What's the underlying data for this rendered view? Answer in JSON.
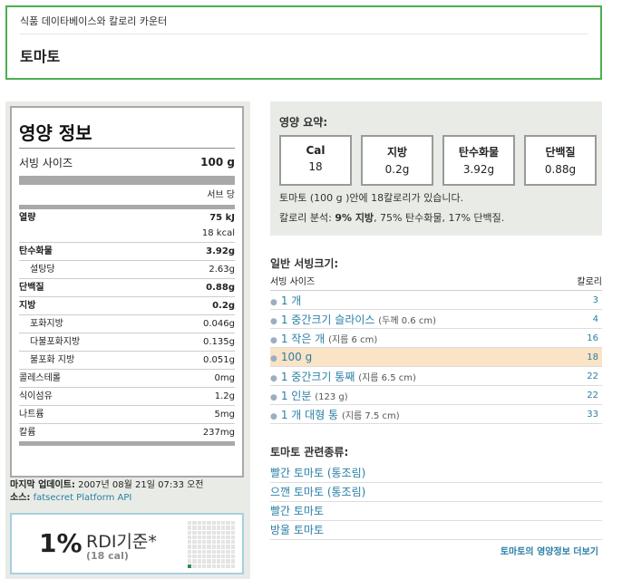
{
  "header": {
    "breadcrumb": "식품 데이타베이스와 칼로리 카운터",
    "title": "토마토"
  },
  "facts": {
    "title": "영양 정보",
    "serving_label": "서빙 사이즈",
    "serving_value": "100 g",
    "per_serving": "서브 당",
    "rows": [
      {
        "k": "열량",
        "v": "75 kJ"
      },
      {
        "k": "",
        "v": "18 kcal"
      },
      {
        "k": "탄수화물",
        "v": "3.92g"
      },
      {
        "k": "설탕당",
        "v": "2.63g"
      },
      {
        "k": "단백질",
        "v": "0.88g"
      },
      {
        "k": "지방",
        "v": "0.2g"
      },
      {
        "k": "포화지방",
        "v": "0.046g"
      },
      {
        "k": "다불포화지방",
        "v": "0.135g"
      },
      {
        "k": "불포화 지방",
        "v": "0.051g"
      },
      {
        "k": "콜레스테롤",
        "v": "0mg"
      },
      {
        "k": "식이섬유",
        "v": "1.2g"
      },
      {
        "k": "나트륨",
        "v": "5mg"
      },
      {
        "k": "칼륨",
        "v": "237mg"
      }
    ]
  },
  "meta": {
    "updated_label": "마지막 업데이트:",
    "updated_value": "2007년 08월 21일 07:33 오전",
    "source_label": "소스:",
    "source_link": "fatsecret Platform API"
  },
  "rdi": {
    "percent": "1%",
    "label": "RDI기준*",
    "cal": "(18 cal)",
    "fraction": 0.01
  },
  "summary": {
    "heading": "영양 요약:",
    "macros": [
      {
        "k": "Cal",
        "v": "18"
      },
      {
        "k": "지방",
        "v": "0.2g"
      },
      {
        "k": "탄수화물",
        "v": "3.92g"
      },
      {
        "k": "단백질",
        "v": "0.88g"
      }
    ],
    "line1": "토마토 (100 g )안에 18칼로리가 있습니다.",
    "line2_prefix": "칼로리 분석: ",
    "line2_bold": "9% 지방",
    "line2_rest": ", 75% 탄수화물, 17% 단백질."
  },
  "servings": {
    "heading": "일반 서빙크기:",
    "col_size": "서빙 사이즈",
    "col_cal": "칼로리",
    "rows": [
      {
        "label": "1 개",
        "sub": "",
        "cal": "3"
      },
      {
        "label": "1 중간크기 슬라이스",
        "sub": "(두께 0.6 cm)",
        "cal": "4"
      },
      {
        "label": "1 작은 개",
        "sub": "(지름 6 cm)",
        "cal": "16"
      },
      {
        "label": "100 g",
        "sub": "",
        "cal": "18"
      },
      {
        "label": "1 중간크기 통째",
        "sub": "(지름 6.5 cm)",
        "cal": "22"
      },
      {
        "label": "1 인분",
        "sub": "(123 g)",
        "cal": "22"
      },
      {
        "label": "1 개 대형 통",
        "sub": "(지름 7.5 cm)",
        "cal": "33"
      }
    ]
  },
  "related": {
    "heading": "토마토 관련종류:",
    "items": [
      "빨간 토마토 (통조림)",
      "으깬 토마토 (통조림)",
      "빨간 토마토",
      "방울 토마토"
    ],
    "more": "토마토의 영양정보 더보기"
  }
}
